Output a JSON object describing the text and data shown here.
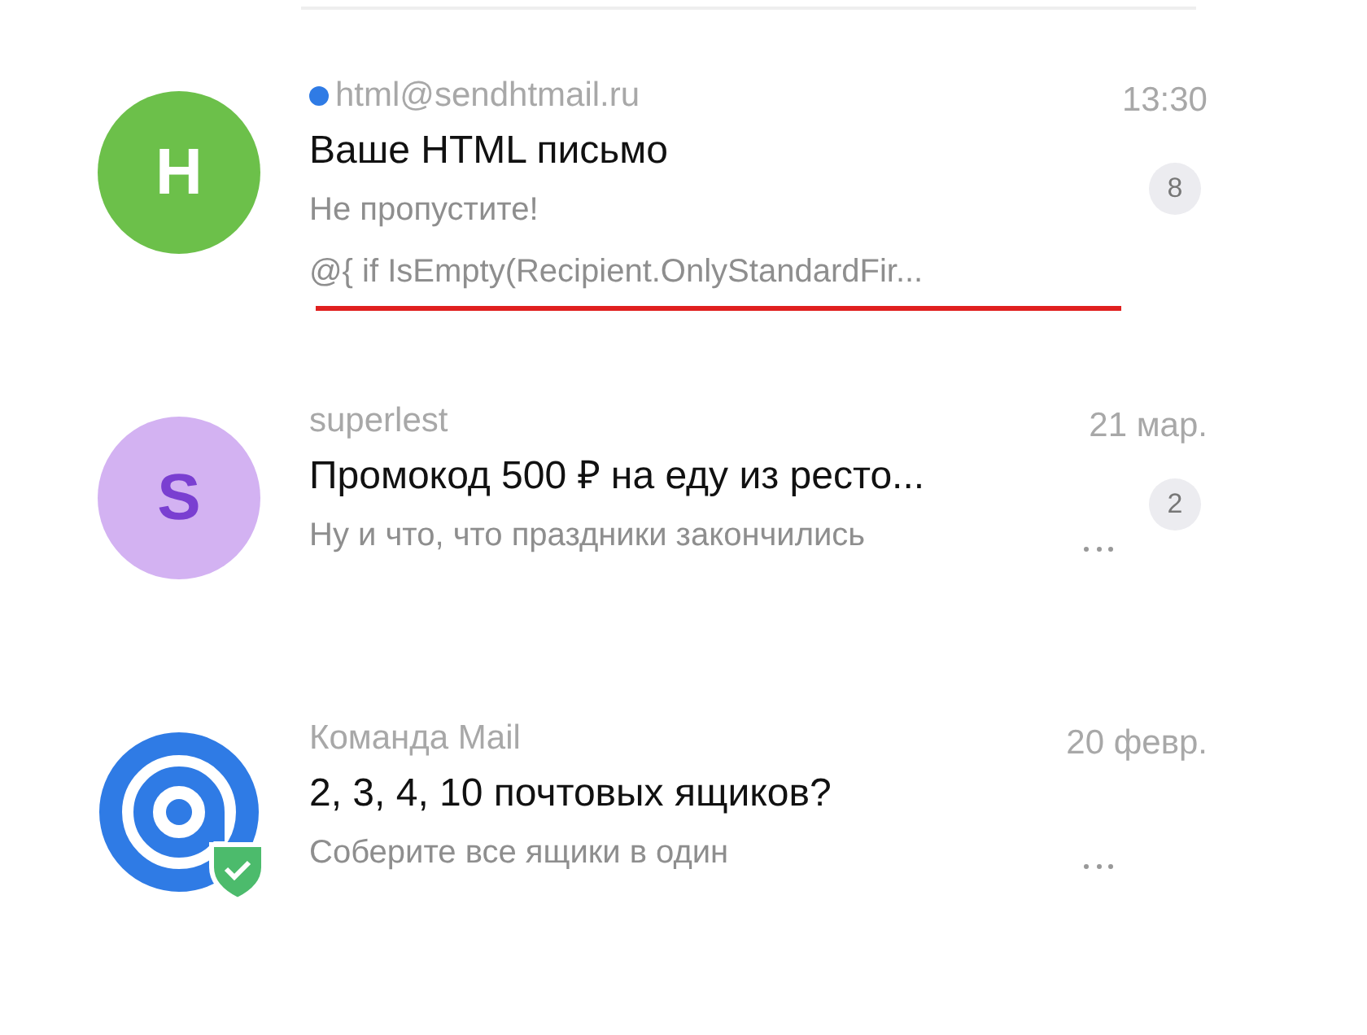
{
  "messages": [
    {
      "avatar": {
        "kind": "letter",
        "letter": "H",
        "color": "#6cc04a"
      },
      "unread": true,
      "sender": "html@sendhtmail.ru",
      "time": "13:30",
      "subject": "Ваше HTML письмо",
      "preview": [
        "Не пропустите!",
        "@{ if IsEmpty(Recipient.OnlyStandardFir..."
      ],
      "underlined": true,
      "count": "8",
      "more": false
    },
    {
      "avatar": {
        "kind": "letter",
        "letter": "S",
        "color": "#d3b2f2"
      },
      "unread": false,
      "sender": "superlest",
      "time": "21 мар.",
      "subject": "Промокод 500 ₽ на еду из ресто...",
      "preview": [
        "Ну и что, что праздники закончились"
      ],
      "underlined": false,
      "count": "2",
      "more": true
    },
    {
      "avatar": {
        "kind": "logo"
      },
      "unread": false,
      "sender": "Команда Mail",
      "time": "20 февр.",
      "subject": "2, 3, 4, 10 почтовых ящиков?",
      "preview": [
        "Соберите все ящики в один"
      ],
      "underlined": false,
      "more": true
    }
  ]
}
